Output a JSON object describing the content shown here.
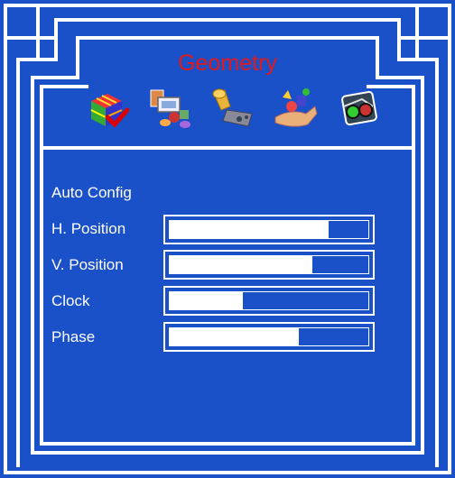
{
  "osd": {
    "title": "Geometry",
    "colors": {
      "background": "#1a50c8",
      "frame": "#ffffff",
      "title": "#e01a1a"
    },
    "icons": [
      {
        "name": "color-cube-icon"
      },
      {
        "name": "geometry-shapes-icon"
      },
      {
        "name": "speaker-settings-icon"
      },
      {
        "name": "hand-objects-icon"
      },
      {
        "name": "glasses-info-icon"
      }
    ],
    "items": [
      {
        "label": "Auto Config"
      },
      {
        "label": "H. Position",
        "level": 0.8
      },
      {
        "label": "V. Position",
        "level": 0.72
      },
      {
        "label": "Clock",
        "level": 0.37
      },
      {
        "label": "Phase",
        "level": 0.65
      }
    ]
  }
}
